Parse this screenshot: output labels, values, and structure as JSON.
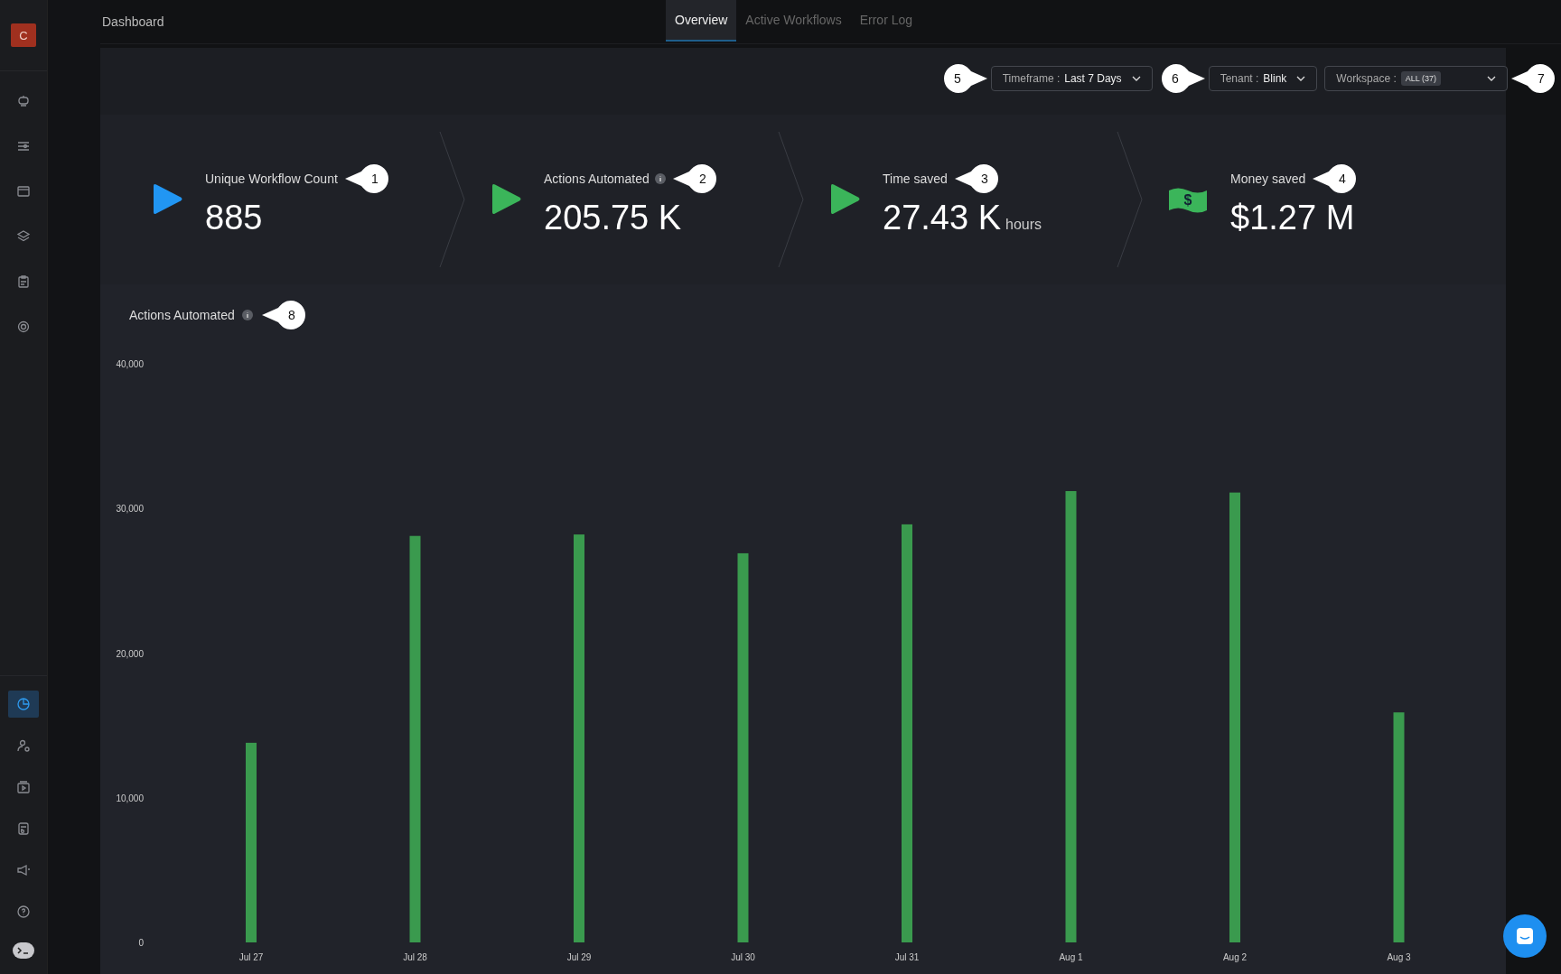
{
  "app": {
    "logo_letter": "C"
  },
  "sidebar": {
    "top_items": [
      {
        "kind": "robot",
        "selected": false
      },
      {
        "kind": "sliders",
        "selected": false
      },
      {
        "kind": "window",
        "selected": false
      },
      {
        "kind": "layers",
        "selected": false
      },
      {
        "kind": "clipboard",
        "selected": false
      },
      {
        "kind": "gear",
        "selected": false
      }
    ],
    "bottom_items": [
      {
        "kind": "pie",
        "selected": true
      },
      {
        "kind": "user-gear",
        "selected": false
      },
      {
        "kind": "play",
        "selected": false
      },
      {
        "kind": "document",
        "selected": false
      },
      {
        "kind": "megaphone",
        "selected": false
      },
      {
        "kind": "help",
        "selected": false
      },
      {
        "kind": "console",
        "selected": false
      }
    ]
  },
  "header": {
    "title": "Dashboard"
  },
  "tabs": [
    {
      "label": "Overview",
      "selected": true
    },
    {
      "label": "Active Workflows",
      "selected": false
    },
    {
      "label": "Error Log",
      "selected": false
    }
  ],
  "filters": [
    {
      "label": "Timeframe :",
      "value": "Last 7 Days",
      "callout": {
        "kind": "leading",
        "text": "5"
      }
    },
    {
      "label": "Tenant :",
      "value": "Blink",
      "callout": {
        "kind": "leading",
        "text": "6"
      }
    },
    {
      "label": "Workspace :",
      "badge": "ALL (37)",
      "callout": {
        "kind": "trailing",
        "text": "7"
      }
    }
  ],
  "kpis": [
    {
      "icon": {
        "kind": "play",
        "color": "#2196f3"
      },
      "label": "Unique Workflow Count",
      "info": false,
      "value": "885",
      "callout": "1"
    },
    {
      "icon": {
        "kind": "play",
        "color": "#3bb55a"
      },
      "label": "Actions Automated",
      "info": true,
      "value": "205.75 K",
      "callout": "2"
    },
    {
      "icon": {
        "kind": "play",
        "color": "#3bb55a"
      },
      "label": "Time saved",
      "info": false,
      "value": "27.43 K",
      "unit": "hours",
      "callout": "3"
    },
    {
      "icon": {
        "kind": "banknote",
        "color": "#3bb55a",
        "glyph": "$"
      },
      "label": "Money saved",
      "info": false,
      "value": "$1.27 M",
      "callout": "4"
    }
  ],
  "chart_panel": {
    "title": "Actions Automated",
    "info": true,
    "callout": "8",
    "chart_data": {
      "type": "bar",
      "categories": [
        "Jul 27",
        "Jul 28",
        "Jul 29",
        "Jul 30",
        "Jul 31",
        "Aug 1",
        "Aug 2",
        "Aug 3"
      ],
      "series": [
        {
          "color": "#3a9a4e",
          "values": [
            13800,
            28100,
            28200,
            26900,
            28900,
            31200,
            31100,
            15900
          ]
        }
      ],
      "ylim": [
        0,
        40000
      ],
      "yticks": [
        {
          "value": 0,
          "label": "0"
        },
        {
          "value": 10000,
          "label": "10,000"
        },
        {
          "value": 20000,
          "label": "20,000"
        },
        {
          "value": 30000,
          "label": "30,000"
        },
        {
          "value": 40000,
          "label": "40,000"
        }
      ]
    }
  }
}
